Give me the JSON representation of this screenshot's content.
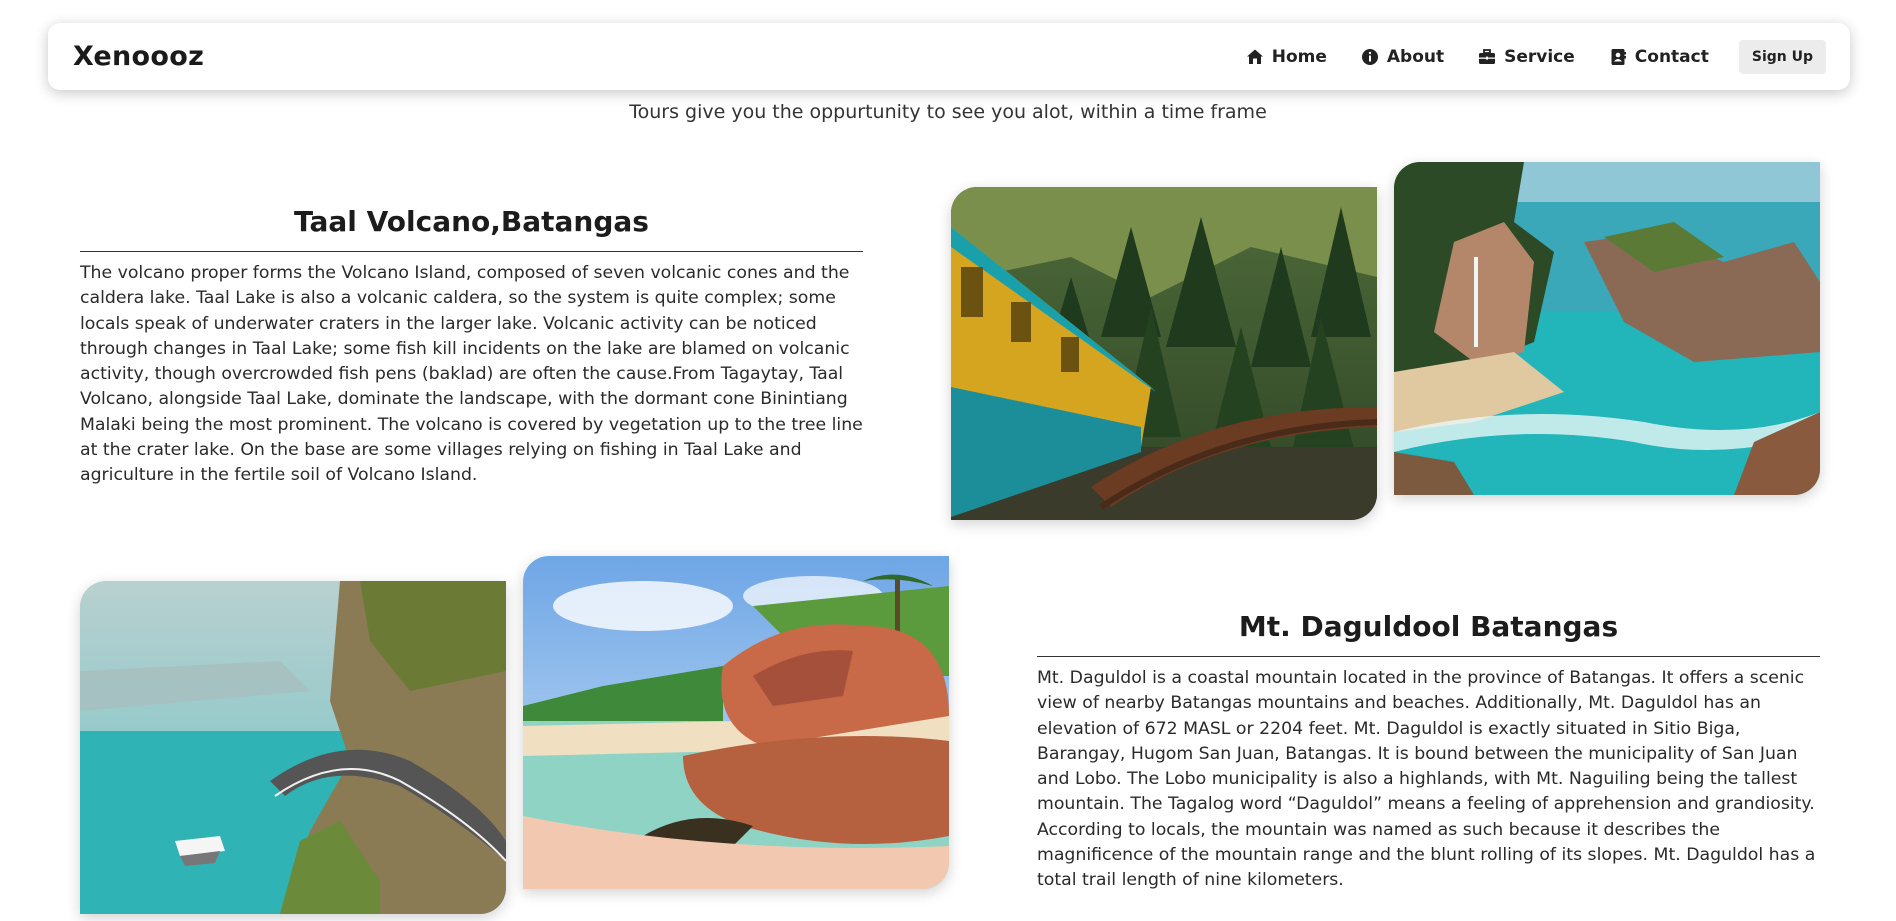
{
  "navbar": {
    "brand": "Xenoooz",
    "links": [
      {
        "label": "Home",
        "icon": "home-icon"
      },
      {
        "label": "About",
        "icon": "info-icon"
      },
      {
        "label": "Service",
        "icon": "briefcase-icon"
      },
      {
        "label": "Contact",
        "icon": "contact-book-icon"
      }
    ],
    "signup_label": "Sign Up"
  },
  "header": {
    "subtitle": "Tours give you the oppurtunity to see you alot, within a time frame"
  },
  "sections": [
    {
      "title": "Taal Volcano,Batangas",
      "body": "The volcano proper forms the Volcano Island, composed of seven volcanic cones and the caldera lake. Taal Lake is also a volcanic caldera, so the system is quite complex; some locals speak of underwater craters in the larger lake. Volcanic activity can be noticed through changes in Taal Lake; some fish kill incidents on the lake are blamed on volcanic activity, though overcrowded fish pens (baklad) are often the cause.From Tagaytay, Taal Volcano, alongside Taal Lake, dominate the landscape, with the dormant cone Binintiang Malaki being the most prominent. The volcano is covered by vegetation up to the tree line at the crater lake. On the base are some villages relying on fishing in Taal Lake and agriculture in the fertile soil of Volcano Island.",
      "images": [
        "train-forest-photo",
        "coastal-waterfall-photo"
      ]
    },
    {
      "title": "Mt. Daguldool Batangas",
      "body": "Mt. Daguldol is a coastal mountain located in the province of Batangas. It offers a scenic view of nearby Batangas mountains and beaches. Additionally, Mt. Daguldol has an elevation of 672 MASL or 2204 feet. Mt. Daguldol is exactly situated in Sitio Biga, Barangay, Hugom San Juan, Batangas. It is bound between the municipality of San Juan and Lobo. The Lobo municipality is also a highlands, with Mt. Naguiling being the tallest mountain. The Tagalog word “Daguldol” means a feeling of apprehension and grandiosity. According to locals, the mountain was named as such because it describes the magnificence of the mountain range and the blunt rolling of its slopes. Mt. Daguldol has a total trail length of nine kilometers.",
      "images": [
        "cliff-road-lake-photo",
        "tropical-rock-beach-photo"
      ]
    }
  ]
}
